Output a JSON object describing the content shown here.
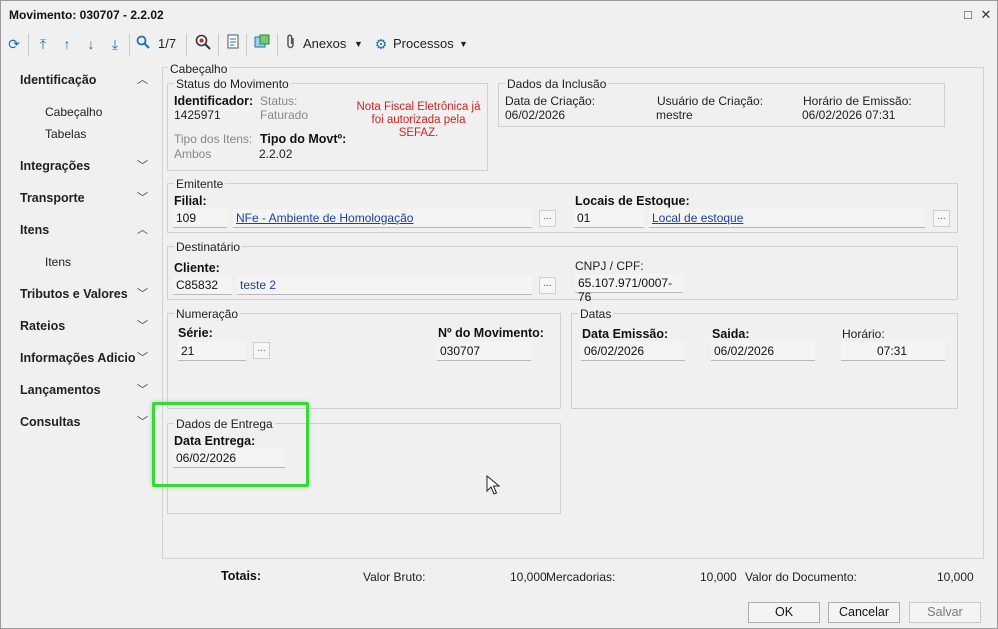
{
  "window": {
    "title": "Movimento: 030707 - 2.2.02"
  },
  "toolbar": {
    "record_counter": "1/7",
    "attachments_label": "Anexos",
    "processes_label": "Processos"
  },
  "sidebar": {
    "sections": [
      {
        "label": "Identificação",
        "expanded": true,
        "subs": [
          "Cabeçalho",
          "Tabelas"
        ]
      },
      {
        "label": "Integrações",
        "expanded": false
      },
      {
        "label": "Transporte",
        "expanded": false
      },
      {
        "label": "Itens",
        "expanded": true,
        "subs": [
          "Itens"
        ]
      },
      {
        "label": "Tributos e Valores",
        "expanded": false
      },
      {
        "label": "Rateios",
        "expanded": false
      },
      {
        "label": "Informações Adicio",
        "expanded": false
      },
      {
        "label": "Lançamentos",
        "expanded": false
      },
      {
        "label": "Consultas",
        "expanded": false
      }
    ]
  },
  "cabecalho": {
    "title": "Cabeçalho"
  },
  "status": {
    "title": "Status do Movimento",
    "identificador_label": "Identificador:",
    "identificador_value": "1425971",
    "status_label": "Status:",
    "status_value": "Faturado",
    "nfe_message": "Nota Fiscal Eletrônica já foi autorizada pela SEFAZ.",
    "tipo_itens_label": "Tipo dos Itens:",
    "tipo_itens_value": "Ambos",
    "tipo_movt_label": "Tipo do Movtº:",
    "tipo_movt_value": "2.2.02"
  },
  "inclusao": {
    "title": "Dados da Inclusão",
    "data_criacao_label": "Data de Criação:",
    "data_criacao_value": "06/02/2026",
    "usuario_label": "Usuário de Criação:",
    "usuario_value": "mestre",
    "horario_label": "Horário de Emissão:",
    "horario_value": "06/02/2026 07:31"
  },
  "emitente": {
    "title": "Emitente",
    "filial_label": "Filial:",
    "filial_code": "109",
    "filial_name": "NFe - Ambiente de Homologação",
    "locais_label": "Locais de Estoque:",
    "locais_code": "01",
    "locais_name": "Local de estoque"
  },
  "destinatario": {
    "title": "Destinatário",
    "cliente_label": "Cliente:",
    "cliente_code": "C85832",
    "cliente_name": "teste 2",
    "cnpj_label": "CNPJ / CPF:",
    "cnpj_value": "65.107.971/0007-76"
  },
  "numeracao": {
    "title": "Numeração",
    "serie_label": "Série:",
    "serie_value": "21",
    "numero_label": "Nº do Movimento:",
    "numero_value": "030707"
  },
  "datas": {
    "title": "Datas",
    "emissao_label": "Data Emissão:",
    "emissao_value": "06/02/2026",
    "saida_label": "Saida:",
    "saida_value": "06/02/2026",
    "horario_label": "Horário:",
    "horario_value": "07:31"
  },
  "entrega": {
    "title": "Dados de Entrega",
    "data_label": "Data Entrega:",
    "data_value": "06/02/2026"
  },
  "totais": {
    "label": "Totais:",
    "valor_bruto_label": "Valor Bruto:",
    "valor_bruto_value": "10,000",
    "mercadorias_label": "Mercadorias:",
    "mercadorias_value": "10,000",
    "valor_documento_label": "Valor do Documento:",
    "valor_documento_value": "10,000"
  },
  "buttons": {
    "ok": "OK",
    "cancel": "Cancelar",
    "save": "Salvar"
  },
  "dots": "...",
  "colors": {
    "highlight": "#36d936",
    "link": "#1a3fa6",
    "error": "#d61f1f",
    "icon": "#1e6fb5"
  }
}
